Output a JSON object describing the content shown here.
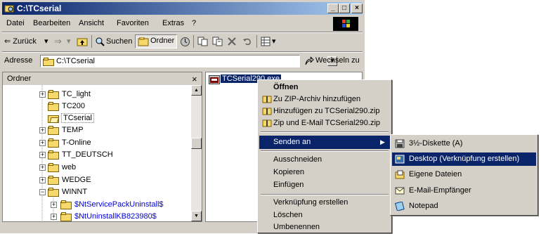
{
  "window": {
    "title": "C:\\TCserial",
    "minimize_glyph": "_",
    "maximize_glyph": "□",
    "close_glyph": "×"
  },
  "menubar": {
    "items": [
      {
        "label": "Datei"
      },
      {
        "label": "Bearbeiten"
      },
      {
        "label": "Ansicht"
      },
      {
        "label": "Favoriten"
      },
      {
        "label": "Extras"
      },
      {
        "label": "?"
      }
    ]
  },
  "toolbar": {
    "back_label": "⇐ Zurück",
    "back_dropdown": "▾",
    "forward_glyph": "⇒",
    "forward_dropdown": "▾",
    "search_label": "Suchen",
    "folders_label": "Ordner",
    "views_dropdown": "▾"
  },
  "address": {
    "label": "Adresse",
    "value": "C:\\TCserial",
    "go_label": "Wechseln zu",
    "dropdown_glyph": "▼"
  },
  "folders_pane": {
    "title": "Ordner",
    "close_glyph": "×",
    "scroll_up_glyph": "▲",
    "scroll_down_glyph": "▼",
    "items": [
      {
        "label": "TC_light",
        "expander": "+"
      },
      {
        "label": "TC200",
        "expander": ""
      },
      {
        "label": "TCserial",
        "expander": ""
      },
      {
        "label": "TEMP",
        "expander": "+"
      },
      {
        "label": "T-Online",
        "expander": "+"
      },
      {
        "label": "TT_DEUTSCH",
        "expander": "+"
      },
      {
        "label": "web",
        "expander": "+"
      },
      {
        "label": "WEDGE",
        "expander": "+"
      },
      {
        "label": "WINNT",
        "expander": "−"
      },
      {
        "label": "$NtServicePackUninstall$",
        "expander": "+"
      },
      {
        "label": "$NtUninstallKB823980$",
        "expander": "+"
      }
    ]
  },
  "files_pane": {
    "selected_file": "TCSerial290.exe"
  },
  "context_menu": {
    "open": "Öffnen",
    "zip_add": "Zu ZIP-Archiv hinzufügen",
    "zip_add_named": "Hinzufügen zu TCSerial290.zip",
    "zip_email": "Zip und E-Mail TCSerial290.zip",
    "send_to": "Senden an",
    "send_to_arrow": "▶",
    "cut": "Ausschneiden",
    "copy": "Kopieren",
    "paste": "Einfügen",
    "create_shortcut": "Verknüpfung erstellen",
    "delete": "Löschen",
    "rename": "Umbenennen"
  },
  "send_to_menu": {
    "items": [
      {
        "label": "3½-Diskette (A)",
        "icon": "floppy-icon"
      },
      {
        "label": "Desktop (Verknüpfung erstellen)",
        "icon": "desktop-icon"
      },
      {
        "label": "Eigene Dateien",
        "icon": "my-documents-icon"
      },
      {
        "label": "E-Mail-Empfänger",
        "icon": "mail-icon"
      },
      {
        "label": "Notepad",
        "icon": "notepad-icon"
      }
    ]
  },
  "colors": {
    "selection": "#0a246a",
    "folder": "#f5d96b",
    "window_bg": "#d4d0c8"
  }
}
